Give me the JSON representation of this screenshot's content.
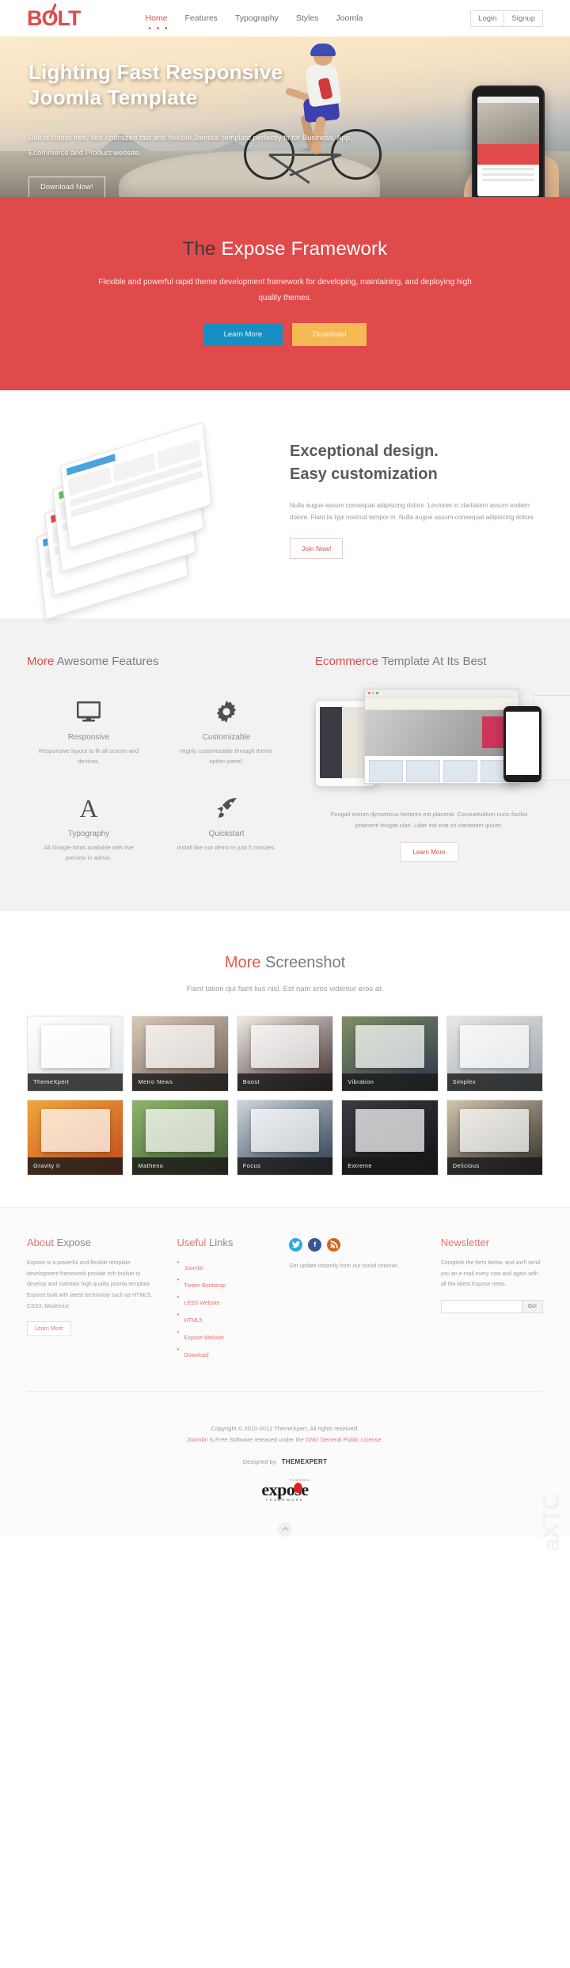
{
  "header": {
    "logo_text": "BOLT",
    "nav": [
      {
        "label": "Home",
        "active": true
      },
      {
        "label": "Features",
        "active": false
      },
      {
        "label": "Typography",
        "active": false
      },
      {
        "label": "Styles",
        "active": false
      },
      {
        "label": "Joomla",
        "active": false
      }
    ],
    "login_label": "Login",
    "signup_label": "Signup"
  },
  "hero": {
    "title_line1": "Lighting Fast Responsive",
    "title_line2": "Joomla Template",
    "subtitle": "Bolt is clutter free, seo optimized fast and flexible Joomla! template perfectly fit for Business, App, Ecommerce and Product website.",
    "button_label": "Download Now!"
  },
  "expose_section": {
    "title_dark": "The",
    "title_light": "Expose Framework",
    "description": "Flexible and powerful rapid theme development framework for developing, maintaining, and deploying high quality themes.",
    "learn_more_label": "Learn More",
    "download_label": "Download",
    "bg_color": "#e04a4a",
    "learn_more_color": "#168fc3",
    "download_color": "#f5b955"
  },
  "design_section": {
    "title_line1": "Exceptional design.",
    "title_line2": "Easy customization",
    "description": "Nulla augue assum consequat adipiscing dolore. Lectores in claritatem assum eodem dolore. Fiant iis typi nostrud tempor in. Nulla augue assum consequat adipiscing dolore.",
    "button_label": "Join Now!"
  },
  "features_section": {
    "heading_highlight": "More",
    "heading_rest": "Awesome Features",
    "items": [
      {
        "icon": "monitor-icon",
        "name": "Responsive",
        "text": "Responsive layout to fit all screen and devices."
      },
      {
        "icon": "gear-icon",
        "name": "Customizable",
        "text": "Highly customizable through theme option panel."
      },
      {
        "icon": "typography-icon",
        "name": "Typography",
        "text": "All Google fonts available with live preview in admin."
      },
      {
        "icon": "rocket-icon",
        "name": "Quickstart",
        "text": "install like our demo in just 5 minutes."
      }
    ]
  },
  "ecommerce_section": {
    "heading_highlight": "Ecommerce",
    "heading_rest": "Template At Its Best",
    "description": "Feugait eorum dynamicus lectores est placerat. Consuetudium nunc facilisi praesent feugiat clari. Liber est erat sit claritatem ipsum.",
    "button_label": "Learn More"
  },
  "screenshots_section": {
    "heading_highlight": "More",
    "heading_rest": "Screenshot",
    "subtitle": "Fiant tation qui fiant lius nisl. Est nam eros videntur eros at.",
    "row1": [
      {
        "label": "ThemeXpert",
        "style": "sh-a"
      },
      {
        "label": "Metro News",
        "style": "sh-b"
      },
      {
        "label": "Boost",
        "style": "sh-c"
      },
      {
        "label": "Vibration",
        "style": "sh-d"
      },
      {
        "label": "Simplex",
        "style": "sh-e"
      }
    ],
    "row2": [
      {
        "label": "Gravity II",
        "style": "sh-f"
      },
      {
        "label": "Matheno",
        "style": "sh-g"
      },
      {
        "label": "Focus",
        "style": "sh-h"
      },
      {
        "label": "Extreme",
        "style": "sh-i"
      },
      {
        "label": "Delicious",
        "style": "sh-j"
      }
    ]
  },
  "footer": {
    "about": {
      "title_highlight": "About",
      "title_rest": "Expose",
      "text": "Expose is a powerful and flexible template development framework provide rich toolset to develop and maintain high quality joomla template. Expose built with latest technoloty such as HTML5, CSS3, Modernizr.",
      "button_label": "Learn More"
    },
    "links": {
      "title_highlight": "Useful",
      "title_rest": "Links",
      "items": [
        "Joomla!",
        "Twitter Bootstrap",
        "LESS Website",
        "HTML5",
        "Expose Website",
        "Download"
      ]
    },
    "social": {
      "icons": [
        "twitter-icon",
        "facebook-icon",
        "rss-icon"
      ],
      "text": "Get update instantly from our social channel.",
      "twitter_color": "#2eaae0",
      "facebook_color": "#3a5795",
      "rss_color": "#d4641c"
    },
    "newsletter": {
      "title": "Newsletter",
      "text": "Complete the form below, and we'll send you an e-mail every now and again with all the latest Expose news.",
      "input_value": "",
      "input_placeholder": "",
      "go_label": "Go!"
    },
    "copyright_line1": "Copyright © 2010-2012 ThemeXpert, All rights reserved.",
    "copyright_joomla": "Joomla!",
    "copyright_mid": " is Free Software released under the ",
    "copyright_license": "GNU General Public License",
    "copyright_end": ".",
    "designed_by": "Designed by:",
    "designer_name": "THEMEXPERT",
    "expose_powered": "POWERED BY",
    "expose_word": "expose",
    "expose_framework": "FRAMEWORK",
    "to_top_icon": "chevron-up-icon",
    "watermark": "JoomlaXTC"
  }
}
